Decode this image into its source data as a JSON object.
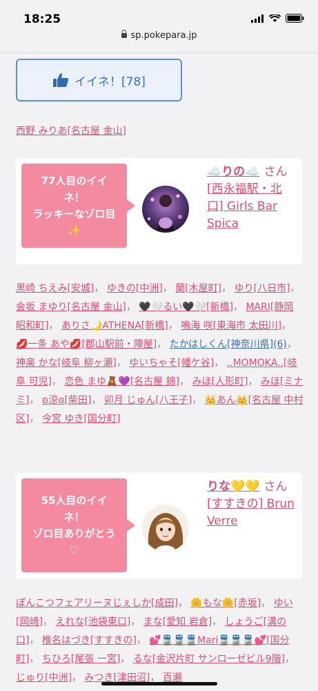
{
  "status": {
    "time": "18:25"
  },
  "url": {
    "host": "sp.pokepara.jp"
  },
  "like": {
    "label": "イイネ！[78]",
    "icon": "thumbs-up-icon"
  },
  "recent": {
    "label": "西野 みりあ[名古屋 金山]"
  },
  "card1": {
    "bubble_l1": "77人目のイイ",
    "bubble_l2": "ネ！",
    "bubble_l3": "ラッキーなゾロ目",
    "bubble_l4": "✨",
    "name": "☁️りの☁️",
    "san": "さん",
    "shop": "[西永福駅・北口] Girls Bar Spica"
  },
  "list1": [
    {
      "t": "黒崎 ちえみ[安城]"
    },
    {
      "t": "ゆきの[中洲]"
    },
    {
      "t": "蘭[木屋町]"
    },
    {
      "t": "ゆり[八日市]"
    },
    {
      "t": "会坂 まゆり[名古屋 金山]"
    },
    {
      "t": "🖤🤍るい🖤🤍[新橋]"
    },
    {
      "t": "MARI[静岡 昭和町]"
    },
    {
      "t": "ありさ🌙ATHENA[新橋]"
    },
    {
      "t": "鳴海 咲[東海市 太田川]"
    },
    {
      "t": "💋一条 あや💋[郡山駅前・陣屋]"
    },
    {
      "t": "たかはしくん[神奈川県](6)",
      "blue": true
    },
    {
      "t": "神楽 かな[岐阜 柳ヶ瀬]"
    },
    {
      "t": "ゆいちゃそ[幡ケ谷]"
    },
    {
      "t": "..MOMOKA..[岐阜 可児]"
    },
    {
      "t": "恋色 まゆ🧸💜[名古屋 錦]"
    },
    {
      "t": "みほ[人形町]"
    },
    {
      "t": "みほ[ミナミ]"
    },
    {
      "t": "ʚ涼ɞ[柴田]"
    },
    {
      "t": "卯月 じゅん[八王子]"
    },
    {
      "t": "👑あん👑[名古屋 中村区]"
    },
    {
      "t": "今宮 ゆき[国分町]"
    }
  ],
  "card2": {
    "bubble_l1": "55人目のイイ",
    "bubble_l2": "ネ！",
    "bubble_l3": "ゾロ目ありがとう",
    "bubble_l4": "♡",
    "name": "りな💛💛",
    "san": "さん",
    "shop": "[すすきの] Brun Verre"
  },
  "list2": [
    {
      "t": "ぽんこつフェアリーヌじぇしか[成田]"
    },
    {
      "t": "🌼もな🌼[赤坂]"
    },
    {
      "t": "ゆい[岡崎]"
    },
    {
      "t": "えれな[池袋東口]"
    },
    {
      "t": "まな[愛知 岩倉]"
    },
    {
      "t": "しょうご[溝の口]"
    },
    {
      "t": "椎名はづき[すすきの]"
    },
    {
      "t": "💕🚆🚆🚆Mari🚆🚆🚆💕[国分町]"
    },
    {
      "t": "ちひろ[尾張 一宮]"
    },
    {
      "t": "るな[金沢片町 サンローゼビル9階]"
    },
    {
      "t": "じゅり[中洲]"
    },
    {
      "t": "みつき[津田沼]"
    },
    {
      "t": "百瀬"
    }
  ],
  "colors": {
    "accent": "#d94f73",
    "bubble": "#f48aa0",
    "button": "#5b8fcf",
    "background": "#f2f2f5"
  }
}
